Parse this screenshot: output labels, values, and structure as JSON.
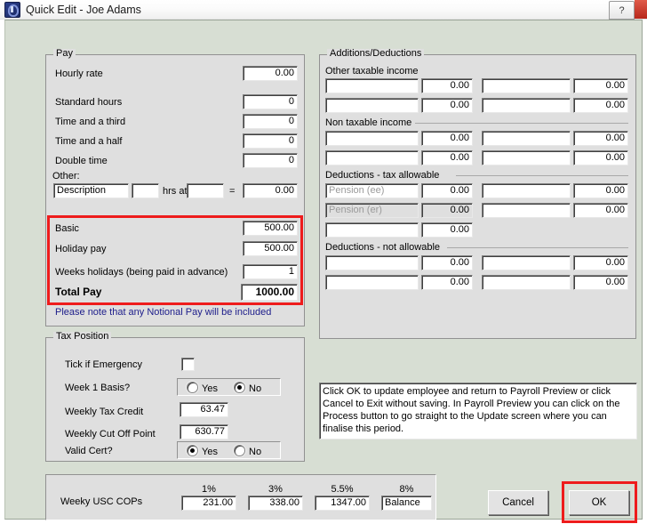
{
  "window": {
    "title": "Quick Edit - Joe Adams",
    "icon": "app-icon",
    "help_button": "?",
    "close_button": ""
  },
  "pay": {
    "legend": "Pay",
    "rows": [
      {
        "label": "Hourly rate",
        "value": "0.00"
      },
      {
        "label": "Standard hours",
        "value": "0"
      },
      {
        "label": "Time and a third",
        "value": "0"
      },
      {
        "label": "Time and a half",
        "value": "0"
      },
      {
        "label": "Double time",
        "value": "0"
      }
    ],
    "other_label": "Other:",
    "other": {
      "description": "Description",
      "hours": "",
      "hrs_at_label": "hrs at",
      "rate": "",
      "equals_label": "=",
      "amount": "0.00"
    },
    "highlighted": [
      {
        "label": "Basic",
        "value": "500.00"
      },
      {
        "label": "Holiday pay",
        "value": "500.00"
      },
      {
        "label": "Weeks holidays (being paid in advance)",
        "value": "1"
      }
    ],
    "total": {
      "label": "Total Pay",
      "value": "1000.00"
    },
    "note": "Please note that any Notional Pay will be included"
  },
  "tax_position": {
    "legend": "Tax Position",
    "emergency_label": "Tick if Emergency",
    "emergency_checked": false,
    "week1_label": "Week 1 Basis?",
    "week1_yes": "Yes",
    "week1_no": "No",
    "week1_selected": "No",
    "tax_credit_label": "Weekly Tax Credit",
    "tax_credit_value": "63.47",
    "cut_off_label": "Weekly Cut Off Point",
    "cut_off_value": "630.77",
    "valid_cert_label": "Valid Cert?",
    "valid_cert_yes": "Yes",
    "valid_cert_no": "No",
    "valid_cert_selected": "Yes"
  },
  "additions_deductions": {
    "legend": "Additions/Deductions",
    "sections": [
      {
        "title": "Other taxable income",
        "rows": [
          {
            "desc_l": "",
            "amt_l": "0.00",
            "desc_r": "",
            "amt_r": "0.00"
          },
          {
            "desc_l": "",
            "amt_l": "0.00",
            "desc_r": "",
            "amt_r": "0.00"
          }
        ]
      },
      {
        "title": "Non taxable income",
        "rows": [
          {
            "desc_l": "",
            "amt_l": "0.00",
            "desc_r": "",
            "amt_r": "0.00"
          },
          {
            "desc_l": "",
            "amt_l": "0.00",
            "desc_r": "",
            "amt_r": "0.00"
          }
        ]
      },
      {
        "title": "Deductions - tax allowable",
        "rows": [
          {
            "desc_l": "Pension (ee)",
            "desc_l_placeholder": true,
            "amt_l": "0.00",
            "desc_r": "",
            "amt_r": "0.00"
          },
          {
            "desc_l": "Pension (er)",
            "desc_l_placeholder": true,
            "amt_l": "0.00",
            "amt_l_disabled": true,
            "desc_r": "",
            "amt_r": "0.00"
          },
          {
            "desc_l": "",
            "amt_l": "0.00",
            "desc_r": null,
            "amt_r": null
          }
        ]
      },
      {
        "title": "Deductions - not allowable",
        "rows": [
          {
            "desc_l": "",
            "amt_l": "0.00",
            "desc_r": "",
            "amt_r": "0.00"
          },
          {
            "desc_l": "",
            "amt_l": "0.00",
            "desc_r": "",
            "amt_r": "0.00"
          }
        ]
      }
    ]
  },
  "info": {
    "text": "Click OK to update employee and return to Payroll Preview or click Cancel to Exit without saving. In Payroll Preview you can click on the Process button to go straight to the Update screen where you can finalise this period."
  },
  "usc": {
    "label": "Weeky USC COPs",
    "bands": [
      {
        "pct": "1%",
        "value": "231.00"
      },
      {
        "pct": "3%",
        "value": "338.00"
      },
      {
        "pct": "5.5%",
        "value": "1347.00"
      },
      {
        "pct": "8%",
        "value": "Balance"
      }
    ]
  },
  "buttons": {
    "cancel": "Cancel",
    "ok": "OK"
  },
  "annotations": {
    "accent_color": "#ee1c1c",
    "note_color": "#1c1c8a"
  }
}
